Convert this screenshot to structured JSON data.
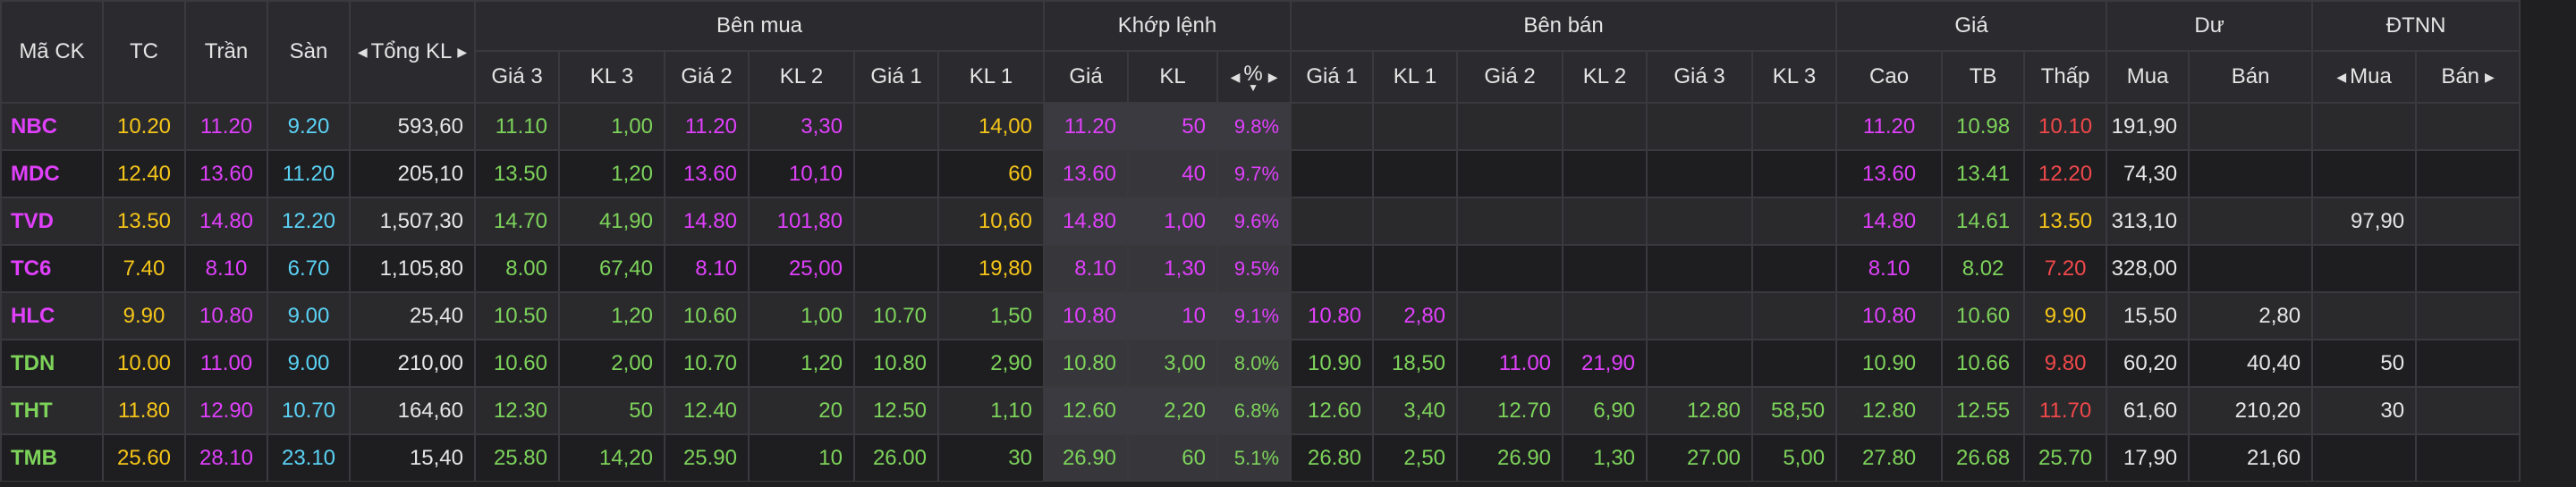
{
  "header": {
    "ma_ck": "Mã CK",
    "tc": "TC",
    "tran": "Trần",
    "san": "Sàn",
    "tong_kl": "Tổng KL",
    "ben_mua": "Bên mua",
    "khop_lenh": "Khớp lệnh",
    "ben_ban": "Bên bán",
    "gia": "Giá",
    "du": "Dư",
    "dtnn": "ĐTNN",
    "buy_cols": [
      "Giá 3",
      "KL 3",
      "Giá 2",
      "KL 2",
      "Giá 1",
      "KL 1"
    ],
    "match_cols": [
      "Giá",
      "KL",
      "%"
    ],
    "sell_cols": [
      "Giá 1",
      "KL 1",
      "Giá 2",
      "KL 2",
      "Giá 3",
      "KL 3"
    ],
    "price_cols": [
      "Cao",
      "TB",
      "Thấp"
    ],
    "du_cols": [
      "Mua",
      "Bán"
    ],
    "dtnn_cols": [
      "Mua",
      "Bán"
    ]
  },
  "colors": {
    "ref": "#f5c518",
    "ceiling": "#e040fb",
    "floor": "#5ad2f4",
    "up": "#7dd35a",
    "down": "#f0484a",
    "neutral": "#e6e6e6"
  },
  "rows": [
    {
      "sym": "NBC",
      "sym_c": "ceil",
      "tc": "10.20",
      "tran": "11.20",
      "san": "9.20",
      "tong": "593,60",
      "b_g3": "11.10",
      "b_g3c": "up",
      "b_k3": "1,00",
      "b_k3c": "up",
      "b_g2": "11.20",
      "b_g2c": "ceil",
      "b_k2": "3,30",
      "b_k2c": "ceil",
      "b_g1": "",
      "b_g1c": "w",
      "b_k1": "14,00",
      "b_k1c": "ref",
      "m_g": "11.20",
      "m_gc": "ceil",
      "m_k": "50",
      "m_kc": "ceil",
      "m_p": "9.8%",
      "m_pc": "ceil",
      "s_g1": "",
      "s_g1c": "w",
      "s_k1": "",
      "s_k1c": "w",
      "s_g2": "",
      "s_g2c": "w",
      "s_k2": "",
      "s_k2c": "w",
      "s_g3": "",
      "s_g3c": "w",
      "s_k3": "",
      "s_k3c": "w",
      "cao": "11.20",
      "caoc": "ceil",
      "tb": "10.98",
      "tbc": "up",
      "thap": "10.10",
      "thapc": "down",
      "du_mua": "191,90",
      "du_ban": "",
      "nn_mua": "",
      "nn_ban": ""
    },
    {
      "sym": "MDC",
      "sym_c": "ceil",
      "tc": "12.40",
      "tran": "13.60",
      "san": "11.20",
      "tong": "205,10",
      "b_g3": "13.50",
      "b_g3c": "up",
      "b_k3": "1,20",
      "b_k3c": "up",
      "b_g2": "13.60",
      "b_g2c": "ceil",
      "b_k2": "10,10",
      "b_k2c": "ceil",
      "b_g1": "",
      "b_g1c": "w",
      "b_k1": "60",
      "b_k1c": "ref",
      "m_g": "13.60",
      "m_gc": "ceil",
      "m_k": "40",
      "m_kc": "ceil",
      "m_p": "9.7%",
      "m_pc": "ceil",
      "s_g1": "",
      "s_g1c": "w",
      "s_k1": "",
      "s_k1c": "w",
      "s_g2": "",
      "s_g2c": "w",
      "s_k2": "",
      "s_k2c": "w",
      "s_g3": "",
      "s_g3c": "w",
      "s_k3": "",
      "s_k3c": "w",
      "cao": "13.60",
      "caoc": "ceil",
      "tb": "13.41",
      "tbc": "up",
      "thap": "12.20",
      "thapc": "down",
      "du_mua": "74,30",
      "du_ban": "",
      "nn_mua": "",
      "nn_ban": ""
    },
    {
      "sym": "TVD",
      "sym_c": "ceil",
      "tc": "13.50",
      "tran": "14.80",
      "san": "12.20",
      "tong": "1,507,30",
      "b_g3": "14.70",
      "b_g3c": "up",
      "b_k3": "41,90",
      "b_k3c": "up",
      "b_g2": "14.80",
      "b_g2c": "ceil",
      "b_k2": "101,80",
      "b_k2c": "ceil",
      "b_g1": "",
      "b_g1c": "w",
      "b_k1": "10,60",
      "b_k1c": "ref",
      "m_g": "14.80",
      "m_gc": "ceil",
      "m_k": "1,00",
      "m_kc": "ceil",
      "m_p": "9.6%",
      "m_pc": "ceil",
      "s_g1": "",
      "s_g1c": "w",
      "s_k1": "",
      "s_k1c": "w",
      "s_g2": "",
      "s_g2c": "w",
      "s_k2": "",
      "s_k2c": "w",
      "s_g3": "",
      "s_g3c": "w",
      "s_k3": "",
      "s_k3c": "w",
      "cao": "14.80",
      "caoc": "ceil",
      "tb": "14.61",
      "tbc": "up",
      "thap": "13.50",
      "thapc": "ref",
      "du_mua": "313,10",
      "du_ban": "",
      "nn_mua": "97,90",
      "nn_ban": ""
    },
    {
      "sym": "TC6",
      "sym_c": "ceil",
      "tc": "7.40",
      "tran": "8.10",
      "san": "6.70",
      "tong": "1,105,80",
      "b_g3": "8.00",
      "b_g3c": "up",
      "b_k3": "67,40",
      "b_k3c": "up",
      "b_g2": "8.10",
      "b_g2c": "ceil",
      "b_k2": "25,00",
      "b_k2c": "ceil",
      "b_g1": "",
      "b_g1c": "w",
      "b_k1": "19,80",
      "b_k1c": "ref",
      "m_g": "8.10",
      "m_gc": "ceil",
      "m_k": "1,30",
      "m_kc": "ceil",
      "m_p": "9.5%",
      "m_pc": "ceil",
      "s_g1": "",
      "s_g1c": "w",
      "s_k1": "",
      "s_k1c": "w",
      "s_g2": "",
      "s_g2c": "w",
      "s_k2": "",
      "s_k2c": "w",
      "s_g3": "",
      "s_g3c": "w",
      "s_k3": "",
      "s_k3c": "w",
      "cao": "8.10",
      "caoc": "ceil",
      "tb": "8.02",
      "tbc": "up",
      "thap": "7.20",
      "thapc": "down",
      "du_mua": "328,00",
      "du_ban": "",
      "nn_mua": "",
      "nn_ban": ""
    },
    {
      "sym": "HLC",
      "sym_c": "ceil",
      "tc": "9.90",
      "tran": "10.80",
      "san": "9.00",
      "tong": "25,40",
      "b_g3": "10.50",
      "b_g3c": "up",
      "b_k3": "1,20",
      "b_k3c": "up",
      "b_g2": "10.60",
      "b_g2c": "up",
      "b_k2": "1,00",
      "b_k2c": "up",
      "b_g1": "10.70",
      "b_g1c": "up",
      "b_k1": "1,50",
      "b_k1c": "up",
      "m_g": "10.80",
      "m_gc": "ceil",
      "m_k": "10",
      "m_kc": "ceil",
      "m_p": "9.1%",
      "m_pc": "ceil",
      "s_g1": "10.80",
      "s_g1c": "ceil",
      "s_k1": "2,80",
      "s_k1c": "ceil",
      "s_g2": "",
      "s_g2c": "w",
      "s_k2": "",
      "s_k2c": "w",
      "s_g3": "",
      "s_g3c": "w",
      "s_k3": "",
      "s_k3c": "w",
      "cao": "10.80",
      "caoc": "ceil",
      "tb": "10.60",
      "tbc": "up",
      "thap": "9.90",
      "thapc": "ref",
      "du_mua": "15,50",
      "du_ban": "2,80",
      "nn_mua": "",
      "nn_ban": ""
    },
    {
      "sym": "TDN",
      "sym_c": "up",
      "tc": "10.00",
      "tran": "11.00",
      "san": "9.00",
      "tong": "210,00",
      "b_g3": "10.60",
      "b_g3c": "up",
      "b_k3": "2,00",
      "b_k3c": "up",
      "b_g2": "10.70",
      "b_g2c": "up",
      "b_k2": "1,20",
      "b_k2c": "up",
      "b_g1": "10.80",
      "b_g1c": "up",
      "b_k1": "2,90",
      "b_k1c": "up",
      "m_g": "10.80",
      "m_gc": "up",
      "m_k": "3,00",
      "m_kc": "up",
      "m_p": "8.0%",
      "m_pc": "up",
      "s_g1": "10.90",
      "s_g1c": "up",
      "s_k1": "18,50",
      "s_k1c": "up",
      "s_g2": "11.00",
      "s_g2c": "ceil",
      "s_k2": "21,90",
      "s_k2c": "ceil",
      "s_g3": "",
      "s_g3c": "w",
      "s_k3": "",
      "s_k3c": "w",
      "cao": "10.90",
      "caoc": "up",
      "tb": "10.66",
      "tbc": "up",
      "thap": "9.80",
      "thapc": "down",
      "du_mua": "60,20",
      "du_ban": "40,40",
      "nn_mua": "50",
      "nn_ban": ""
    },
    {
      "sym": "THT",
      "sym_c": "up",
      "tc": "11.80",
      "tran": "12.90",
      "san": "10.70",
      "tong": "164,60",
      "b_g3": "12.30",
      "b_g3c": "up",
      "b_k3": "50",
      "b_k3c": "up",
      "b_g2": "12.40",
      "b_g2c": "up",
      "b_k2": "20",
      "b_k2c": "up",
      "b_g1": "12.50",
      "b_g1c": "up",
      "b_k1": "1,10",
      "b_k1c": "up",
      "m_g": "12.60",
      "m_gc": "up",
      "m_k": "2,20",
      "m_kc": "up",
      "m_p": "6.8%",
      "m_pc": "up",
      "s_g1": "12.60",
      "s_g1c": "up",
      "s_k1": "3,40",
      "s_k1c": "up",
      "s_g2": "12.70",
      "s_g2c": "up",
      "s_k2": "6,90",
      "s_k2c": "up",
      "s_g3": "12.80",
      "s_g3c": "up",
      "s_k3": "58,50",
      "s_k3c": "up",
      "cao": "12.80",
      "caoc": "up",
      "tb": "12.55",
      "tbc": "up",
      "thap": "11.70",
      "thapc": "down",
      "du_mua": "61,60",
      "du_ban": "210,20",
      "nn_mua": "30",
      "nn_ban": ""
    },
    {
      "sym": "TMB",
      "sym_c": "up",
      "tc": "25.60",
      "tran": "28.10",
      "san": "23.10",
      "tong": "15,40",
      "b_g3": "25.80",
      "b_g3c": "up",
      "b_k3": "14,20",
      "b_k3c": "up",
      "b_g2": "25.90",
      "b_g2c": "up",
      "b_k2": "10",
      "b_k2c": "up",
      "b_g1": "26.00",
      "b_g1c": "up",
      "b_k1": "30",
      "b_k1c": "up",
      "m_g": "26.90",
      "m_gc": "up",
      "m_k": "60",
      "m_kc": "up",
      "m_p": "5.1%",
      "m_pc": "up",
      "s_g1": "26.80",
      "s_g1c": "up",
      "s_k1": "2,50",
      "s_k1c": "up",
      "s_g2": "26.90",
      "s_g2c": "up",
      "s_k2": "1,30",
      "s_k2c": "up",
      "s_g3": "27.00",
      "s_g3c": "up",
      "s_k3": "5,00",
      "s_k3c": "up",
      "cao": "27.80",
      "caoc": "up",
      "tb": "26.68",
      "tbc": "up",
      "thap": "25.70",
      "thapc": "up",
      "du_mua": "17,90",
      "du_ban": "21,60",
      "nn_mua": "",
      "nn_ban": ""
    }
  ]
}
